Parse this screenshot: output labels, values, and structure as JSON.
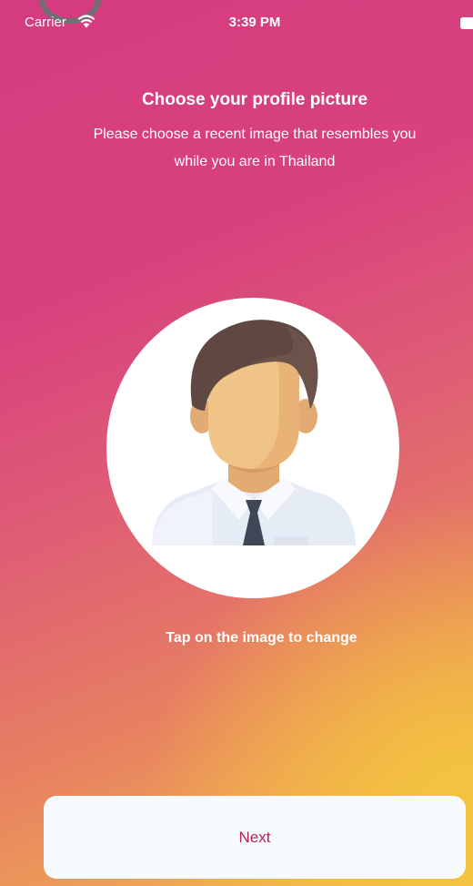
{
  "status_bar": {
    "carrier": "Carrier",
    "time": "3:39 PM"
  },
  "header": {
    "title": "Choose your profile picture",
    "subtitle_line1": "Please choose a recent image that resembles you",
    "subtitle_line2": "while you are in Thailand"
  },
  "avatar": {
    "icon": "default-male-avatar"
  },
  "hint": "Tap on the image to change",
  "footer": {
    "next_label": "Next"
  },
  "colors": {
    "gradient_start": "#d53c7f",
    "gradient_end": "#f4c43e",
    "button_background": "#f7fbfd",
    "button_text": "#b01f5e"
  }
}
